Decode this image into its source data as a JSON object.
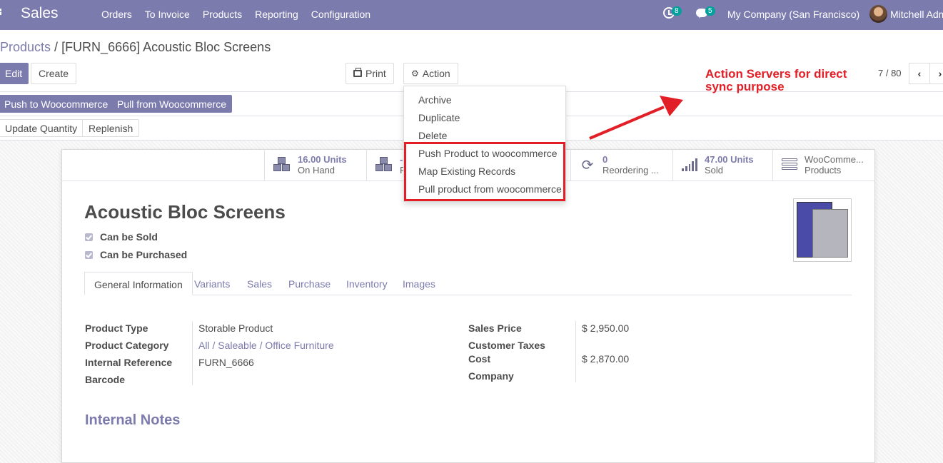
{
  "navbar": {
    "app_title": "Sales",
    "menu": [
      "Orders",
      "To Invoice",
      "Products",
      "Reporting",
      "Configuration"
    ],
    "activity_badge": "8",
    "messages_badge": "5",
    "company": "My Company (San Francisco)",
    "user": "Mitchell Adm"
  },
  "breadcrumb": {
    "parent": "Products",
    "separator": " / ",
    "current": "[FURN_6666] Acoustic Bloc Screens"
  },
  "toolbar": {
    "edit": "Edit",
    "create": "Create",
    "print": "Print",
    "action": "Action"
  },
  "pager": {
    "value": "7 / 80",
    "prev": "‹",
    "next": "›"
  },
  "buttons": {
    "push_woo": "Push to Woocommerce",
    "pull_woo": "Pull from Woocommerce",
    "update_qty": "Update Quantity",
    "replenish": "Replenish"
  },
  "action_menu": [
    "Archive",
    "Duplicate",
    "Delete",
    "Push Product to woocommerce",
    "Map Existing Records",
    "Pull product from woocommerce"
  ],
  "annotation": {
    "line1": "Action Servers for direct",
    "line2": "sync purpose"
  },
  "stats": {
    "on_hand_value": "16.00 Units",
    "on_hand_label": "On Hand",
    "forecast_value": "-",
    "forecast_label": "F",
    "reordering_value": "0",
    "reordering_label": "Reordering ...",
    "sold_value": "47.00 Units",
    "sold_label": "Sold",
    "woo_value": "WooComme...",
    "woo_label": "Products"
  },
  "product": {
    "name": "Acoustic Bloc Screens",
    "can_be_sold": "Can be Sold",
    "can_be_purchased": "Can be Purchased"
  },
  "tabs": [
    "General Information",
    "Variants",
    "Sales",
    "Purchase",
    "Inventory",
    "Images"
  ],
  "fields_left": {
    "type_label": "Product Type",
    "type_value": "Storable Product",
    "category_label": "Product Category",
    "category_value": "All / Saleable / Office Furniture",
    "ref_label": "Internal Reference",
    "ref_value": "FURN_6666",
    "barcode_label": "Barcode"
  },
  "fields_right": {
    "price_label": "Sales Price",
    "price_value": "$ 2,950.00",
    "taxes_label": "Customer Taxes",
    "cost_label": "Cost",
    "cost_value": "$ 2,870.00",
    "company_label": "Company"
  },
  "notes_title": "Internal Notes",
  "colors": {
    "brand": "#7c7bad",
    "highlight": "#e21f26",
    "badge": "#00a09d"
  }
}
